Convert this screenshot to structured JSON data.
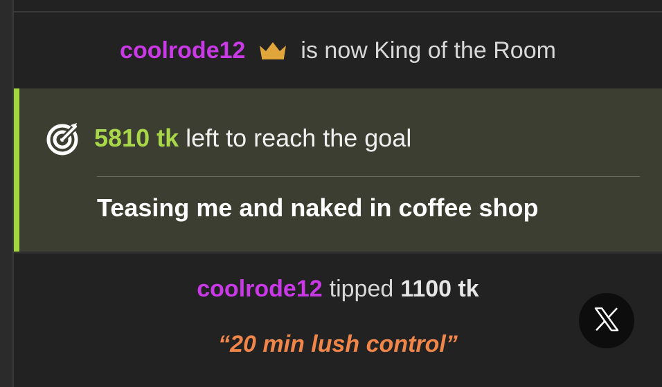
{
  "king_notice": {
    "username": "coolrode12",
    "crown_icon": "crown-icon",
    "text": "is now King of the Room",
    "username_color": "#c93ae6",
    "crown_color": "#e0a63b"
  },
  "goal": {
    "icon": "target-icon",
    "amount": "5810 tk",
    "text": "left to reach the goal",
    "title": "Teasing me and naked in coffee shop",
    "accent_color": "#a4d63f"
  },
  "tip": {
    "username": "coolrode12",
    "verb": "tipped",
    "amount": "1100 tk",
    "message": "“20 min lush control”",
    "message_color": "#f0864a"
  },
  "share_button": {
    "icon": "x-logo-icon"
  }
}
